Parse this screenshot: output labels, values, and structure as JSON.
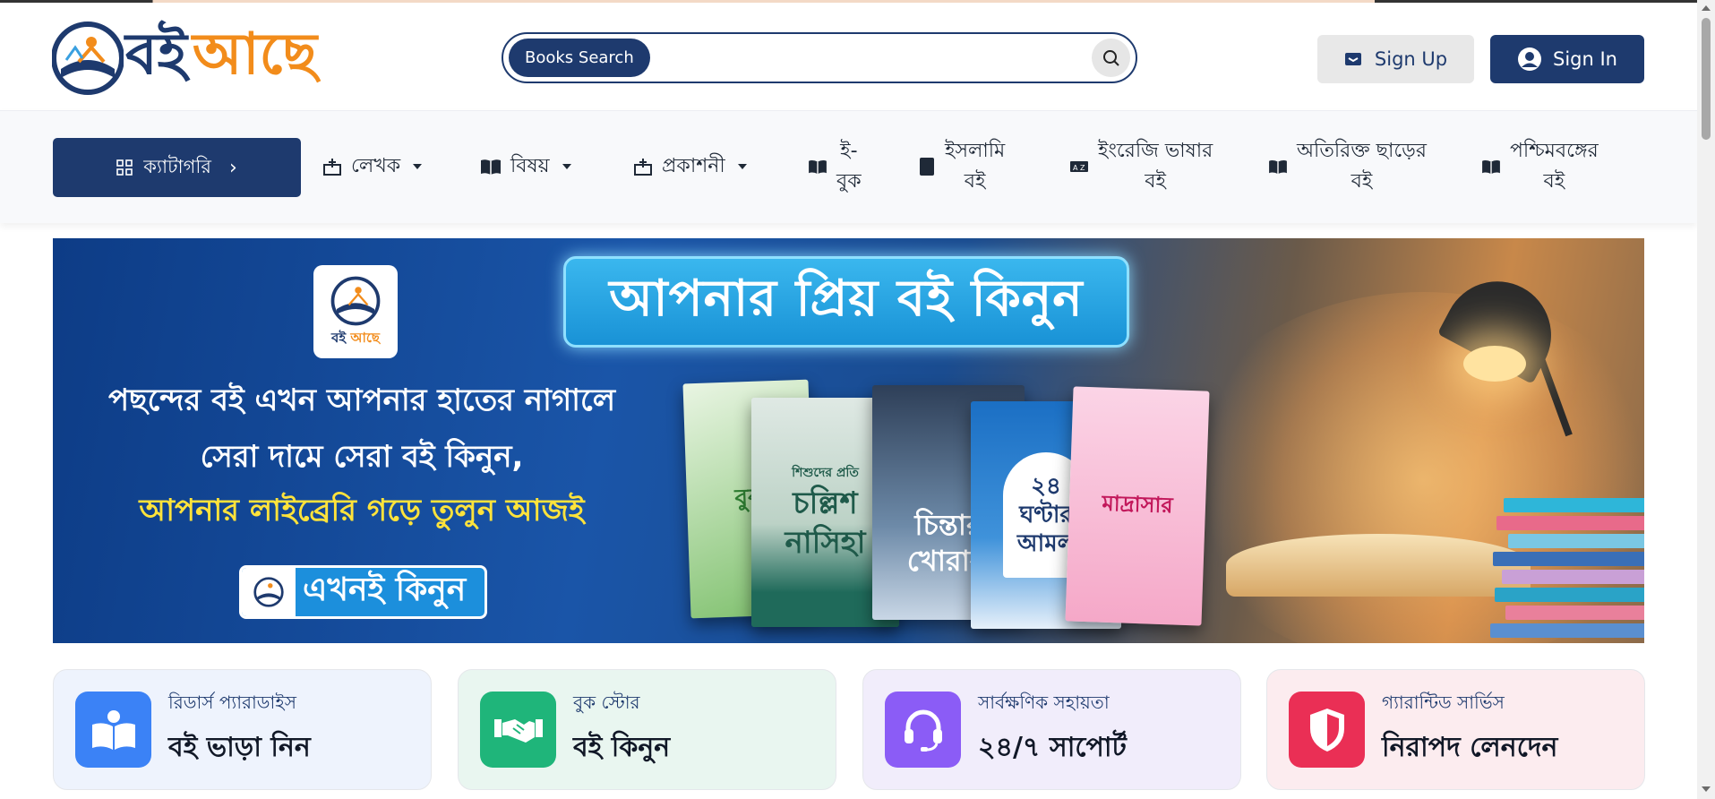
{
  "header": {
    "logo": {
      "part1": "বই",
      "part2": "আছে"
    },
    "search": {
      "pill_label": "Books Search",
      "placeholder": "",
      "value": "",
      "icon": "search-icon"
    },
    "signup_label": "Sign Up",
    "signin_label": "Sign In"
  },
  "nav": {
    "category_label": "ক্যাটাগরি",
    "items": [
      {
        "label": "লেখক",
        "icon": "writer-icon",
        "dropdown": true
      },
      {
        "label": "বিষয়",
        "icon": "book-open-icon",
        "dropdown": true
      },
      {
        "label": "প্রকাশনী",
        "icon": "publisher-icon",
        "dropdown": true
      },
      {
        "label_line1": "ই-",
        "label_line2": "বুক",
        "icon": "ebook-icon"
      },
      {
        "label_line1": "ইসলামি",
        "label_line2": "বই",
        "icon": "quran-icon"
      },
      {
        "label_line1": "ইংরেজি ভাষার",
        "label_line2": "বই",
        "icon": "language-icon"
      },
      {
        "label_line1": "অতিরিক্ত ছাড়ের",
        "label_line2": "বই",
        "icon": "book-open-icon"
      },
      {
        "label_line1": "পশ্চিমবঙ্গের",
        "label_line2": "বই",
        "icon": "book-open-icon"
      }
    ]
  },
  "banner": {
    "logo_part1": "বই",
    "logo_part2": "আছে",
    "headline": "আপনার প্রিয় বই কিনুন",
    "line1": "পছন্দের বই এখন আপনার হাতের নাগালে",
    "line2": "সেরা দামে সেরা বই কিনুন,",
    "line3": "আপনার লাইব্রেরি গড়ে তুলুন আজই",
    "cta": "এখনই কিনুন",
    "books": [
      {
        "title": "বুক"
      },
      {
        "title_top": "শিশুদের প্রতি",
        "title": "চল্লিশ নাসিহা"
      },
      {
        "title": "চিন্তার খোরাক"
      },
      {
        "title": "২৪ ঘণ্টার আমল"
      },
      {
        "title": "মাদ্রাসার"
      }
    ]
  },
  "features": [
    {
      "small": "রিডার্স প্যারাডাইস",
      "big": "বই ভাড়া নিন",
      "icon": "reader-icon",
      "color": "#3b82f6",
      "bg": "#eef3fd"
    },
    {
      "small": "বুক স্টোর",
      "big": "বই কিনুন",
      "icon": "handshake-icon",
      "color": "#1fb57a",
      "bg": "#e9f6f0"
    },
    {
      "small": "সার্বক্ষণিক সহায়তা",
      "big": "২৪/৭ সাপোর্ট",
      "icon": "headset-icon",
      "color": "#8b5cf6",
      "bg": "#f1edfb"
    },
    {
      "small": "গ্যারান্টিড সার্ভিস",
      "big": "নিরাপদ লেনদেন",
      "icon": "shield-icon",
      "color": "#ea2f55",
      "bg": "#fcecef"
    }
  ]
}
